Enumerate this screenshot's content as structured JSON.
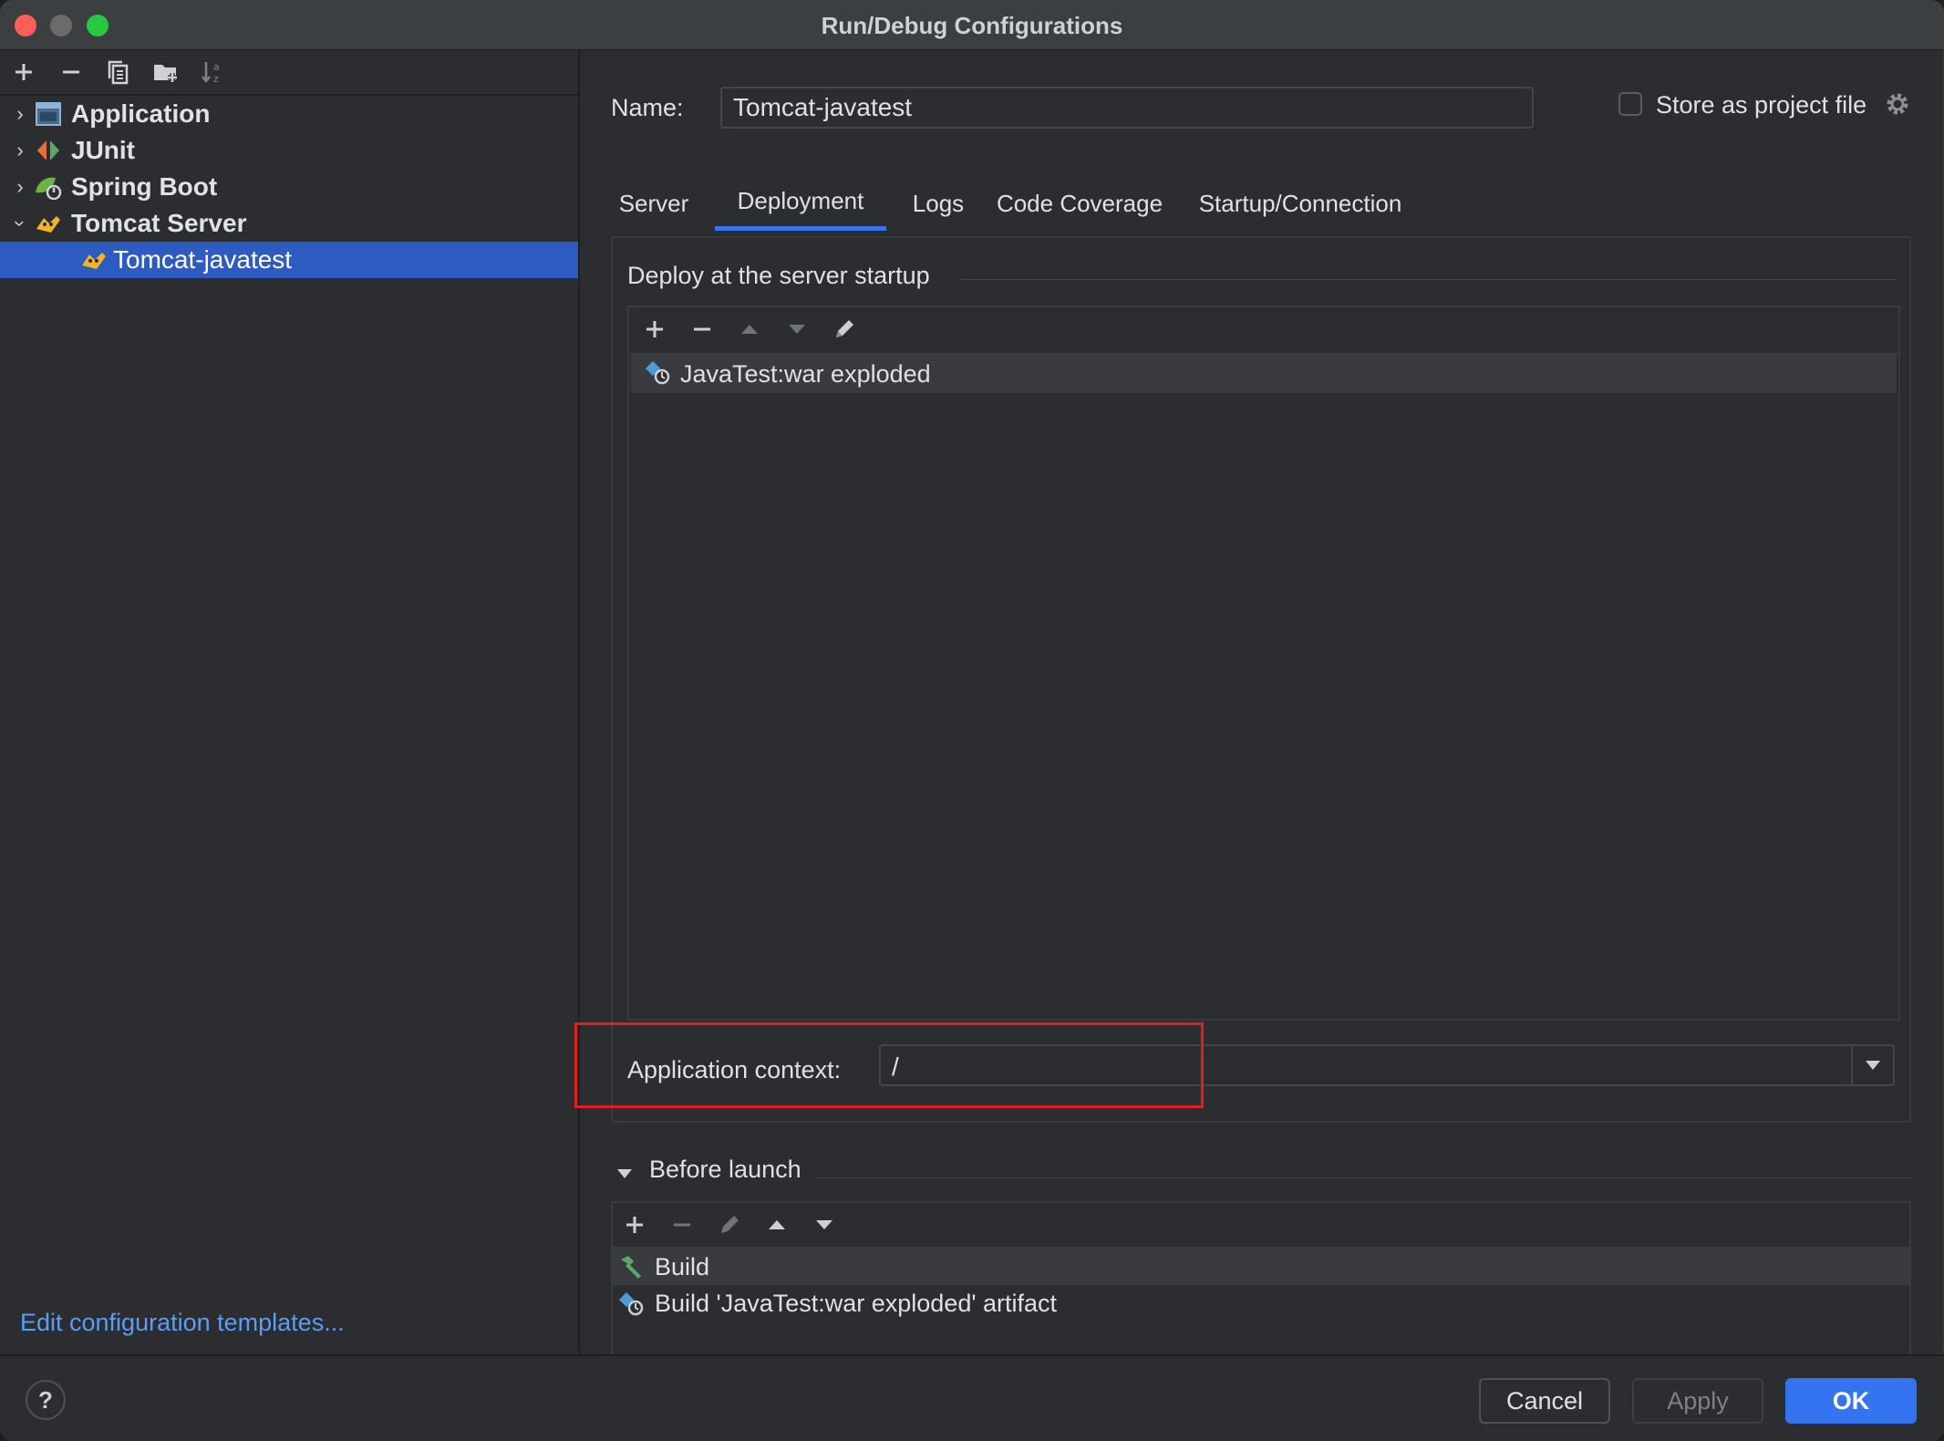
{
  "window": {
    "title": "Run/Debug Configurations"
  },
  "left_toolbar": {
    "icons": [
      "add-icon",
      "remove-icon",
      "copy-icon",
      "new-folder-icon",
      "sort-icon"
    ]
  },
  "tree": {
    "items": [
      {
        "label": "Application",
        "expanded": false,
        "icon": "application-icon"
      },
      {
        "label": "JUnit",
        "expanded": false,
        "icon": "junit-icon"
      },
      {
        "label": "Spring Boot",
        "expanded": false,
        "icon": "spring-boot-icon"
      },
      {
        "label": "Tomcat Server",
        "expanded": true,
        "icon": "tomcat-icon"
      }
    ],
    "selected_child": {
      "label": "Tomcat-javatest",
      "icon": "tomcat-icon"
    }
  },
  "edit_templates_link": "Edit configuration templates...",
  "name_field": {
    "label": "Name:",
    "value": "Tomcat-javatest"
  },
  "store_as_project_file": {
    "label": "Store as project file",
    "checked": false
  },
  "tabs": [
    {
      "label": "Server",
      "active": false
    },
    {
      "label": "Deployment",
      "active": true
    },
    {
      "label": "Logs",
      "active": false
    },
    {
      "label": "Code Coverage",
      "active": false
    },
    {
      "label": "Startup/Connection",
      "active": false
    }
  ],
  "deployment": {
    "section_title": "Deploy at the server startup",
    "artifacts": [
      {
        "label": "JavaTest:war exploded",
        "icon": "artifact-icon"
      }
    ],
    "app_context": {
      "label": "Application context:",
      "value": "/"
    }
  },
  "before_launch": {
    "title": "Before launch",
    "tasks": [
      {
        "label": "Build",
        "icon": "hammer-icon"
      },
      {
        "label": "Build 'JavaTest:war exploded' artifact",
        "icon": "artifact-icon"
      }
    ]
  },
  "buttons": {
    "help": "?",
    "cancel": "Cancel",
    "apply": "Apply",
    "ok": "OK"
  },
  "colors": {
    "accent": "#3574f0",
    "selection": "#2e5bbf",
    "highlight_border": "#e0201e",
    "link": "#589df6"
  }
}
